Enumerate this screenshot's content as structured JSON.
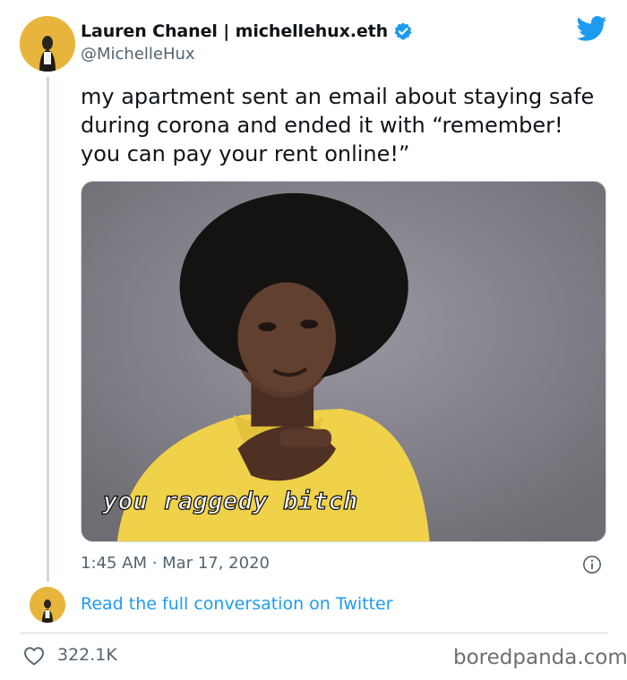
{
  "tweet": {
    "author_name": "Lauren Chanel | michellehux.eth",
    "handle": "@MichelleHux",
    "verified": true,
    "text": "my apartment sent an email about staying safe during corona and ended it with “remember! you can pay your rent online!”",
    "media_caption": "you raggedy bitch",
    "timestamp": "1:45 AM · Mar 17, 2020",
    "read_more_label": "Read the full conversation on Twitter",
    "like_count": "322.1K"
  },
  "icons": {
    "brand": "twitter-bird-icon",
    "verified": "verified-badge-icon",
    "info": "info-icon",
    "like": "heart-icon"
  },
  "colors": {
    "accent": "#1d9bf0",
    "secondary_text": "#536471",
    "avatar_bg": "#e7b53c"
  },
  "watermark": "boredpanda.com"
}
